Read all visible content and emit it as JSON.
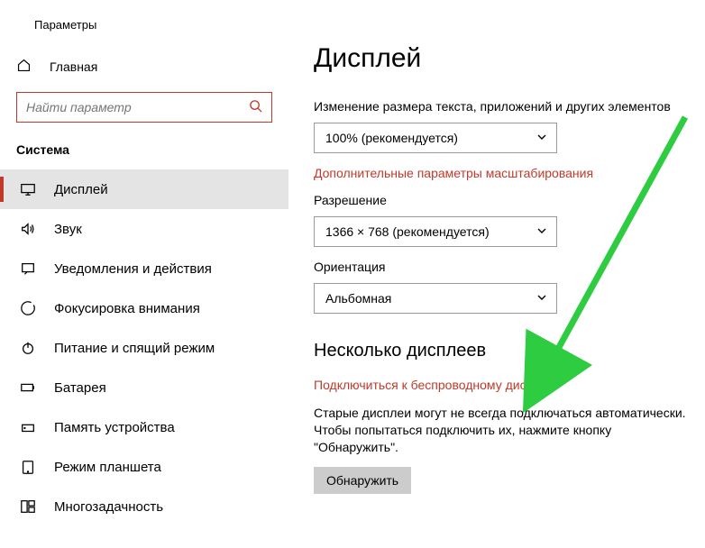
{
  "header": {
    "app_title": "Параметры",
    "home_label": "Главная"
  },
  "search": {
    "placeholder": "Найти параметр"
  },
  "sidebar": {
    "section_title": "Система",
    "items": [
      {
        "label": "Дисплей"
      },
      {
        "label": "Звук"
      },
      {
        "label": "Уведомления и действия"
      },
      {
        "label": "Фокусировка внимания"
      },
      {
        "label": "Питание и спящий режим"
      },
      {
        "label": "Батарея"
      },
      {
        "label": "Память устройства"
      },
      {
        "label": "Режим планшета"
      },
      {
        "label": "Многозадачность"
      }
    ]
  },
  "main": {
    "title": "Дисплей",
    "scale_label": "Изменение размера текста, приложений и других элементов",
    "scale_value": "100% (рекомендуется)",
    "scale_link": "Дополнительные параметры масштабирования",
    "resolution_label": "Разрешение",
    "resolution_value": "1366 × 768 (рекомендуется)",
    "orientation_label": "Ориентация",
    "orientation_value": "Альбомная",
    "multi_heading": "Несколько дисплеев",
    "wireless_link": "Подключиться к беспроводному дисплею",
    "detect_text": "Старые дисплеи могут не всегда подключаться автоматически. Чтобы попытаться подключить их, нажмите кнопку \"Обнаружить\".",
    "detect_button": "Обнаружить"
  }
}
